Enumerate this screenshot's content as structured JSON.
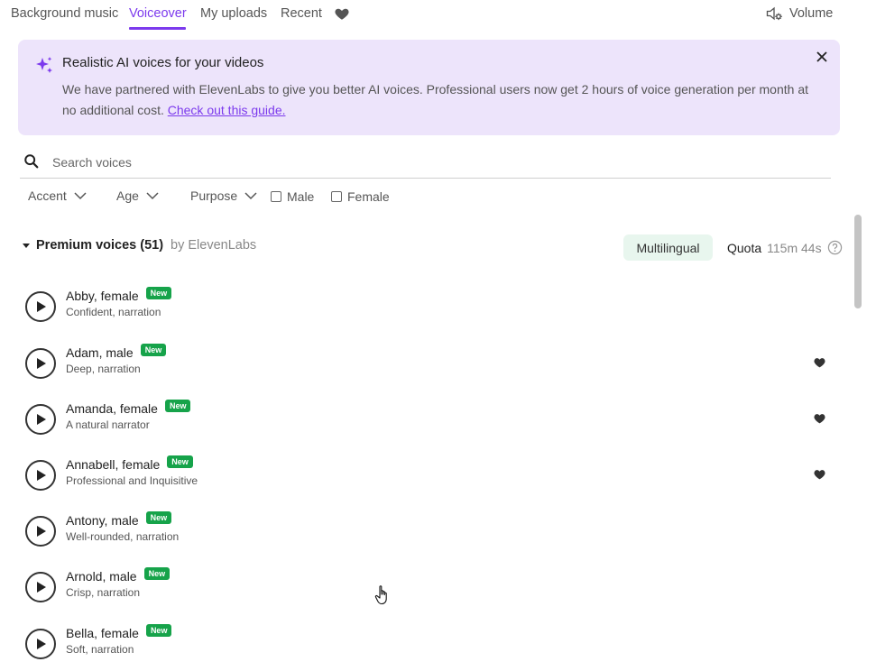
{
  "tabs": [
    {
      "label": "Background music",
      "active": false
    },
    {
      "label": "Voiceover",
      "active": true
    },
    {
      "label": "My uploads",
      "active": false
    },
    {
      "label": "Recent",
      "active": false
    }
  ],
  "favorites_tab_icon": "heart-icon",
  "volume": {
    "label": "Volume",
    "icon": "speaker-settings-icon"
  },
  "banner": {
    "icon": "sparkles-icon",
    "title": "Realistic AI voices for your videos",
    "text": "We have partnered with ElevenLabs to give you better AI voices. Professional users now get 2 hours of voice generation per month at no additional cost.",
    "link": "Check out this guide.",
    "close_icon": "close-icon"
  },
  "search": {
    "placeholder": "Search voices",
    "value": ""
  },
  "filters": [
    {
      "label": "Accent"
    },
    {
      "label": "Age"
    },
    {
      "label": "Purpose"
    }
  ],
  "checkboxes": [
    {
      "label": "Male",
      "checked": false
    },
    {
      "label": "Female",
      "checked": false
    }
  ],
  "section": {
    "title": "Premium voices (51)",
    "by": "by ElevenLabs",
    "badge": "Multilingual",
    "quota_label": "Quota",
    "quota_value": "115m 44s"
  },
  "colors": {
    "accent": "#7c3aed",
    "banner_bg": "#ede4fb",
    "new_badge": "#16a34a",
    "multilingual_bg": "#e8f6ee"
  },
  "voices": [
    {
      "name": "Abby, female",
      "badge": "New",
      "desc": "Confident, narration",
      "favorited": false
    },
    {
      "name": "Adam, male",
      "badge": "New",
      "desc": "Deep, narration",
      "favorited": true
    },
    {
      "name": "Amanda, female",
      "badge": "New",
      "desc": "A natural narrator",
      "favorited": true
    },
    {
      "name": "Annabell, female",
      "badge": "New",
      "desc": "Professional and Inquisitive",
      "favorited": true
    },
    {
      "name": "Antony, male",
      "badge": "New",
      "desc": "Well-rounded, narration",
      "favorited": false
    },
    {
      "name": "Arnold, male",
      "badge": "New",
      "desc": "Crisp, narration",
      "favorited": false
    },
    {
      "name": "Bella, female",
      "badge": "New",
      "desc": "Soft, narration",
      "favorited": false
    }
  ]
}
